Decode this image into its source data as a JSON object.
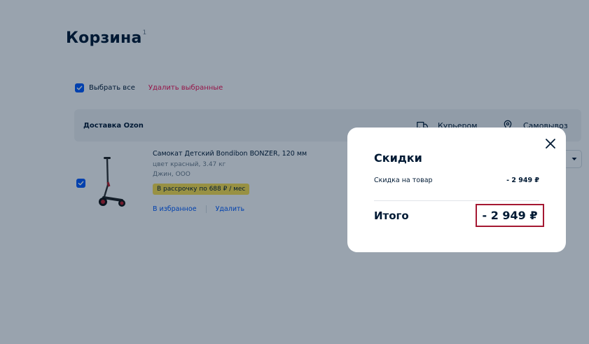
{
  "page": {
    "title": "Корзина",
    "count": "1"
  },
  "cart": {
    "select_all": "Выбрать все",
    "delete_selected": "Удалить выбранные",
    "delivery": {
      "title": "Доставка Ozon",
      "courier": "Курьером",
      "pickup": "Самовывоз"
    },
    "item": {
      "name": "Самокат Детский Bondibon BONZER, 120 мм",
      "attributes": "цвет красный, 3.47 кг",
      "seller": "Джин, ООО",
      "installment": "В рассрочку по 688 ₽ / мес",
      "favorite": "В избранное",
      "delete": "Удалить"
    }
  },
  "modal": {
    "title": "Скидки",
    "discount_label": "Скидка на товар",
    "discount_value": "- 2 949 ₽",
    "total_label": "Итого",
    "total_value": "- 2 949 ₽"
  },
  "colors": {
    "accent": "#005bff",
    "danger": "#f91155",
    "highlight_border": "#a51832",
    "installment_bg": "#fde24e"
  }
}
